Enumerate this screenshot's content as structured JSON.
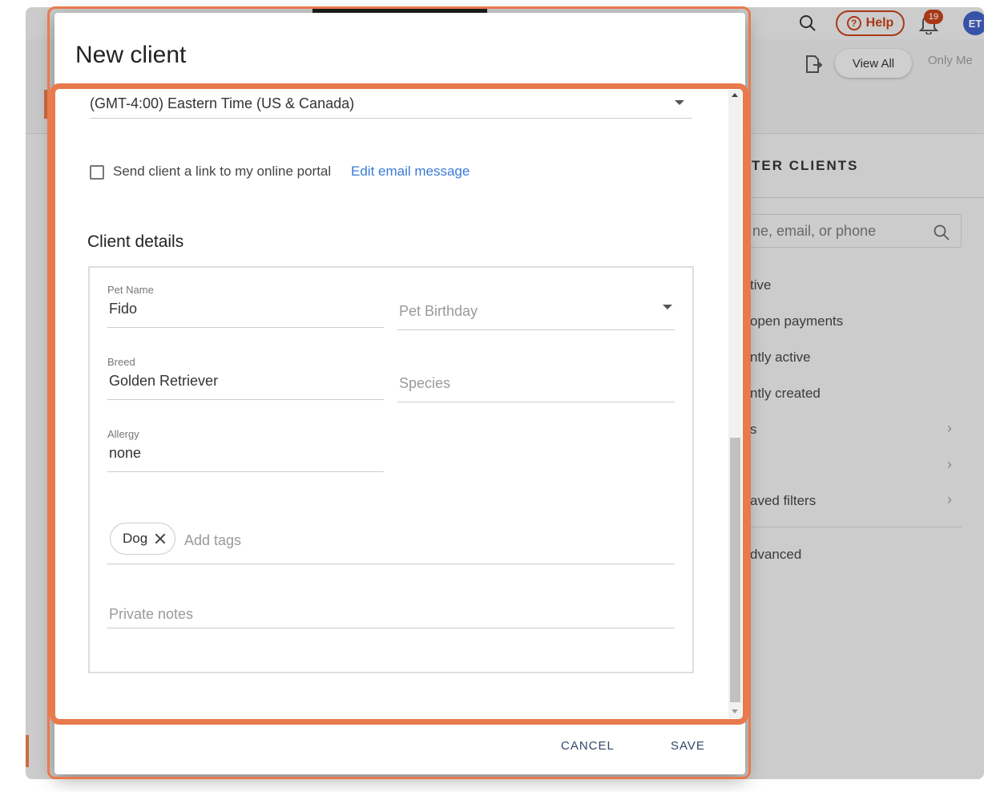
{
  "background": {
    "help_label": "Help",
    "notification_count": "19",
    "avatar_initials": "ET",
    "view_all_label": "View All",
    "only_me_label": "Only Me",
    "filter_title": "TER CLIENTS",
    "search_placeholder": "ne, email, or phone",
    "filters": [
      "tive",
      "open payments",
      "ntly active",
      "ntly created",
      "s",
      "",
      "aved filters",
      "dvanced"
    ]
  },
  "modal": {
    "title": "New client",
    "timezone_value": "(GMT-4:00) Eastern Time (US & Canada)",
    "portal_checkbox_label": "Send client a link to my online portal",
    "edit_email_link": "Edit email message",
    "details_title": "Client details",
    "fields": {
      "pet_name_label": "Pet Name",
      "pet_name_value": "Fido",
      "pet_birthday_placeholder": "Pet Birthday",
      "breed_label": "Breed",
      "breed_value": "Golden Retriever",
      "species_placeholder": "Species",
      "allergy_label": "Allergy",
      "allergy_value": "none"
    },
    "tags": [
      "Dog"
    ],
    "add_tags_placeholder": "Add tags",
    "private_notes_placeholder": "Private notes",
    "cancel_label": "CANCEL",
    "save_label": "SAVE"
  },
  "colors": {
    "highlight": "#e87a4d",
    "link": "#3a7bd5",
    "button_text": "#34476b",
    "brand_red": "#c0401c"
  }
}
